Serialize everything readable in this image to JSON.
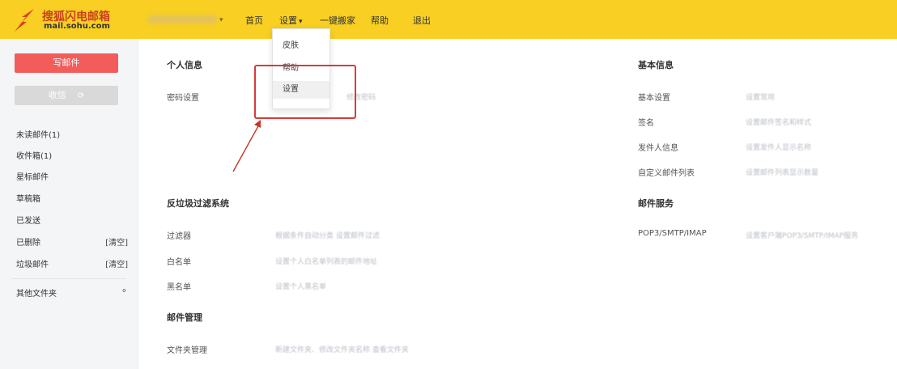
{
  "brand": {
    "title": "搜狐闪电邮箱",
    "url": "mail.sohu.com"
  },
  "nav": {
    "home": "首页",
    "settings": "设置",
    "mailbox_move": "一键搬家",
    "help": "帮助",
    "logout": "退出"
  },
  "dropdown": {
    "items": [
      "皮肤",
      "帮助",
      "设置"
    ]
  },
  "sidebar": {
    "write_label": "写邮件",
    "receive_label": "收信",
    "folders": [
      "未读邮件(1)",
      "收件箱(1)",
      "星标邮件",
      "草稿箱",
      "已发送",
      "已删除",
      "垃圾邮件"
    ],
    "clear_label": "[清空]",
    "other_folders": "其他文件夹"
  },
  "personal": {
    "heading": "个人信息",
    "label": "密码设置",
    "desc": "修改密码"
  },
  "antispam": {
    "heading": "反垃圾过滤系统",
    "rows": [
      {
        "label": "过滤器",
        "desc": "根据条件自动分类  设置邮件过滤"
      },
      {
        "label": "白名单",
        "desc": "设置个人白名单列表的邮件地址"
      },
      {
        "label": "黑名单",
        "desc": "设置个人黑名单"
      }
    ]
  },
  "mailmgmt": {
    "heading": "邮件管理",
    "label": "文件夹管理",
    "desc": "新建文件夹、修改文件夹名称  查看文件夹"
  },
  "basic": {
    "heading": "基本信息",
    "rows": [
      {
        "label": "基本设置",
        "desc": "设置常用"
      },
      {
        "label": "签名",
        "desc": "设置邮件签名和样式"
      },
      {
        "label": "发件人信息",
        "desc": "设置发件人显示名称"
      },
      {
        "label": "自定义邮件列表",
        "desc": "设置邮件列表显示数量"
      }
    ]
  },
  "service": {
    "heading": "邮件服务",
    "label": "POP3/SMTP/IMAP",
    "desc": "设置客户端POP3/SMTP/IMAP服务"
  }
}
